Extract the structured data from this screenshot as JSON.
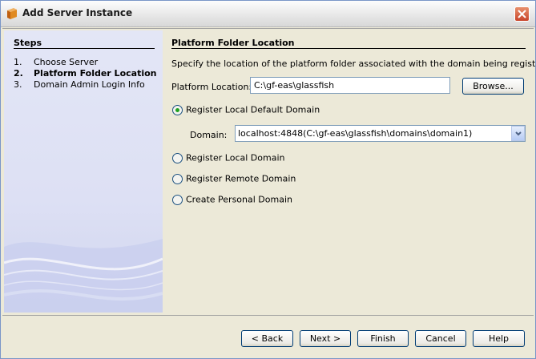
{
  "window": {
    "title": "Add Server Instance"
  },
  "steps": {
    "title": "Steps",
    "items": [
      {
        "num": "1.",
        "label": "Choose Server",
        "current": false
      },
      {
        "num": "2.",
        "label": "Platform Folder Location",
        "current": true
      },
      {
        "num": "3.",
        "label": "Domain Admin Login Info",
        "current": false
      }
    ]
  },
  "panel": {
    "title": "Platform Folder Location",
    "description": "Specify the location of the platform folder associated with the domain being registered.",
    "platform_label": "Platform Location:",
    "platform_value": "C:\\gf-eas\\glassfish",
    "browse_label": "Browse...",
    "domain_label": "Domain:",
    "domain_value": "localhost:4848(C:\\gf-eas\\glassfish\\domains\\domain1)",
    "options": [
      {
        "label": "Register Local Default Domain",
        "checked": true
      },
      {
        "label": "Register Local Domain",
        "checked": false
      },
      {
        "label": "Register Remote Domain",
        "checked": false
      },
      {
        "label": "Create Personal Domain",
        "checked": false
      }
    ]
  },
  "buttons": {
    "back": "< Back",
    "next": "Next >",
    "finish": "Finish",
    "cancel": "Cancel",
    "help": "Help"
  },
  "colors": {
    "radio_selected": "#21a121",
    "close_button": "#c8442a",
    "field_border": "#7f9db9"
  }
}
